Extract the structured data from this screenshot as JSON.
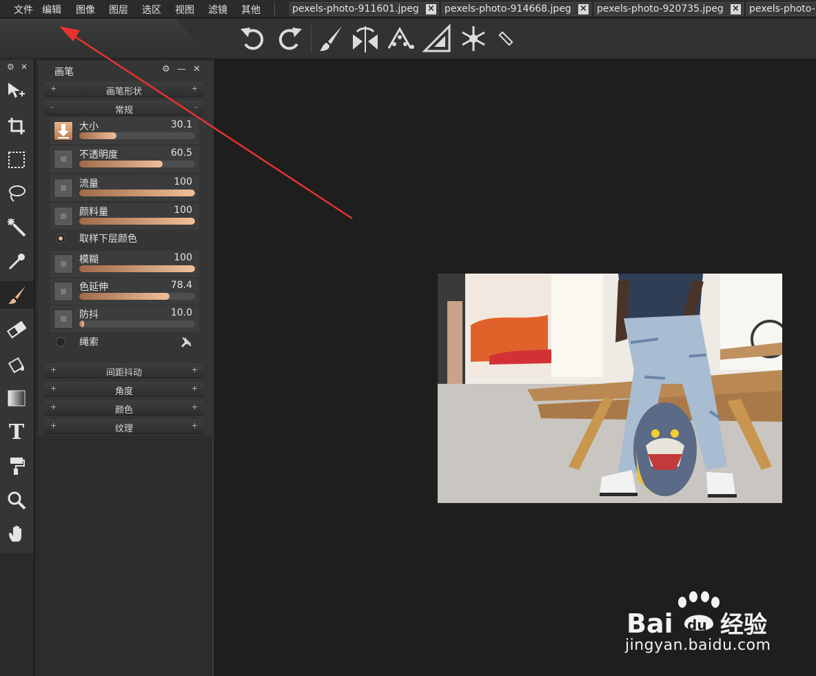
{
  "menu": {
    "items": [
      "文件",
      "编辑",
      "图像",
      "图层",
      "选区",
      "视图",
      "滤镜",
      "其他"
    ]
  },
  "tabs": [
    {
      "label": "pexels-photo-911601.jpeg",
      "close": "×"
    },
    {
      "label": "pexels-photo-914668.jpeg",
      "close": "×"
    },
    {
      "label": "pexels-photo-920735.jpeg",
      "close": "×"
    },
    {
      "label": "pexels-photo-"
    }
  ],
  "toolbar": {
    "icons": [
      "undo-icon",
      "redo-icon",
      "brush-icon",
      "symmetry-icon",
      "scatter-icon",
      "set-square-icon",
      "snowflake-icon",
      "ruler-icon"
    ]
  },
  "tools": [
    "move-tool-icon",
    "crop-tool-icon",
    "marquee-tool-icon",
    "lasso-tool-icon",
    "magic-wand-tool-icon",
    "eyedropper-tool-icon",
    "brush-tool-icon",
    "eraser-tool-icon",
    "paint-bucket-tool-icon",
    "gradient-tool-icon",
    "text-tool-icon",
    "paint-roller-tool-icon",
    "zoom-tool-icon",
    "hand-tool-icon"
  ],
  "toolstrip": {
    "gear": "⚙",
    "close": "✕"
  },
  "panel": {
    "title": "画笔",
    "gear": "⚙",
    "minimize": "—",
    "close": "✕",
    "sections_top": [
      {
        "label": "画笔形状",
        "left": "+",
        "right": "+"
      },
      {
        "label": "常规",
        "left": "-",
        "right": "-"
      }
    ],
    "params": [
      {
        "label": "大小",
        "value": "30.1",
        "level": 0.32,
        "checked": true
      },
      {
        "label": "不透明度",
        "value": "60.5",
        "level": 0.72,
        "checked": false
      },
      {
        "label": "流量",
        "value": "100",
        "level": 1.0,
        "checked": false
      },
      {
        "label": "颜料量",
        "value": "100",
        "level": 1.0,
        "checked": false
      },
      {
        "label": "模糊",
        "value": "100",
        "level": 1.0,
        "checked": false
      },
      {
        "label": "色延伸",
        "value": "78.4",
        "level": 0.78,
        "checked": false
      },
      {
        "label": "防抖",
        "value": "10.0",
        "level": 0.04,
        "checked": false
      }
    ],
    "sample_below": "取样下层颜色",
    "rope": "绳索",
    "rope_icon": "wrench-icon",
    "sections_bottom": [
      {
        "label": "间距抖动",
        "left": "+",
        "right": "+"
      },
      {
        "label": "角度",
        "left": "+",
        "right": "+"
      },
      {
        "label": "颜色",
        "left": "+",
        "right": "+"
      },
      {
        "label": "纹理",
        "left": "+",
        "right": "+"
      }
    ]
  },
  "watermark": {
    "text": "jingyan.baidu.com",
    "logo_text": "Baidu经验"
  },
  "colors": {
    "accent": "#f0b890",
    "arrow": "#e8332f",
    "background": "#1e1e1e"
  }
}
